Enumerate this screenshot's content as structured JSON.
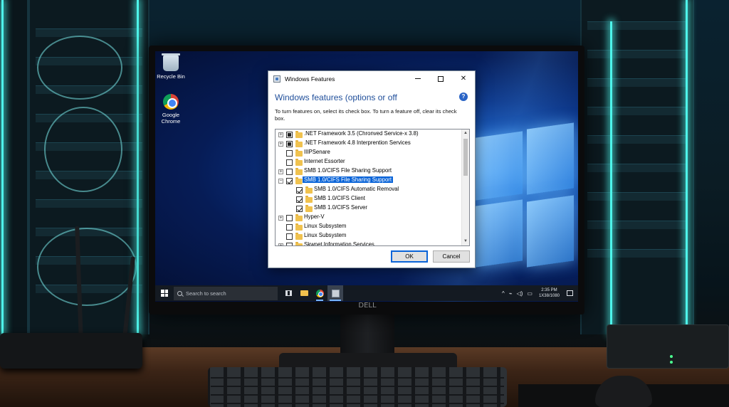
{
  "desktop": {
    "icons": [
      {
        "label": "Recycle Bin",
        "icon": "recycle-bin-icon"
      },
      {
        "label": "Google Chrome",
        "icon": "chrome-icon"
      }
    ]
  },
  "dialog": {
    "title": "Windows Features",
    "heading": "Windows features (options or off",
    "help_symbol": "?",
    "description": "To turn features on, select its check box. To turn a feature off, clear its check box.",
    "features": [
      {
        "label": ".NET Framework 3.5 (Chronved Service-x 3.8)",
        "level": 0,
        "expander": "+",
        "state": "partial",
        "selected": false
      },
      {
        "label": ".NET Framework 4.8 Interprention Services",
        "level": 0,
        "expander": "+",
        "state": "partial",
        "selected": false
      },
      {
        "label": "IIIPSenare",
        "level": 0,
        "expander": "",
        "state": "unchecked",
        "selected": false
      },
      {
        "label": "Internet Essorter",
        "level": 0,
        "expander": "",
        "state": "unchecked",
        "selected": false
      },
      {
        "label": "SMB 1.0/CIFS File Sharing Support",
        "level": 0,
        "expander": "+",
        "state": "unchecked",
        "selected": false
      },
      {
        "label": "SMB 1.0/CIFS File Sharing Support",
        "level": 0,
        "expander": "−",
        "state": "checked",
        "selected": true
      },
      {
        "label": "SMB 1.0/CIFS Automatic Removal",
        "level": 1,
        "expander": "",
        "state": "checked",
        "selected": false
      },
      {
        "label": "SMB 1.0/CIFS Client",
        "level": 1,
        "expander": "",
        "state": "checked",
        "selected": false
      },
      {
        "label": "SMB 1.0/CIFS Server",
        "level": 1,
        "expander": "",
        "state": "checked",
        "selected": false
      },
      {
        "label": "Hyper-V",
        "level": 0,
        "expander": "+",
        "state": "unchecked",
        "selected": false
      },
      {
        "label": "Linux Subsystem",
        "level": 0,
        "expander": "",
        "state": "unchecked",
        "selected": false
      },
      {
        "label": "Linux Subsystem",
        "level": 0,
        "expander": "",
        "state": "unchecked",
        "selected": false
      },
      {
        "label": "Skwnet Information Services",
        "level": 0,
        "expander": "+",
        "state": "unchecked",
        "selected": false
      }
    ],
    "ok_label": "OK",
    "cancel_label": "Cancel"
  },
  "taskbar": {
    "search_placeholder": "Search to search",
    "pinned": [
      "task-view-icon",
      "file-explorer-icon",
      "chrome-icon",
      "windows-features-icon"
    ],
    "tray_symbols": [
      "^",
      "⌁",
      "◁)",
      "▭"
    ],
    "time": "2:35 PM",
    "date": "1X38/1080"
  },
  "monitor": {
    "brand": "DELL"
  },
  "colors": {
    "selection": "#0a64d8",
    "heading": "#1f4e9a",
    "taskbar": "#141a22",
    "accent_glow": "#4ef4ea"
  }
}
